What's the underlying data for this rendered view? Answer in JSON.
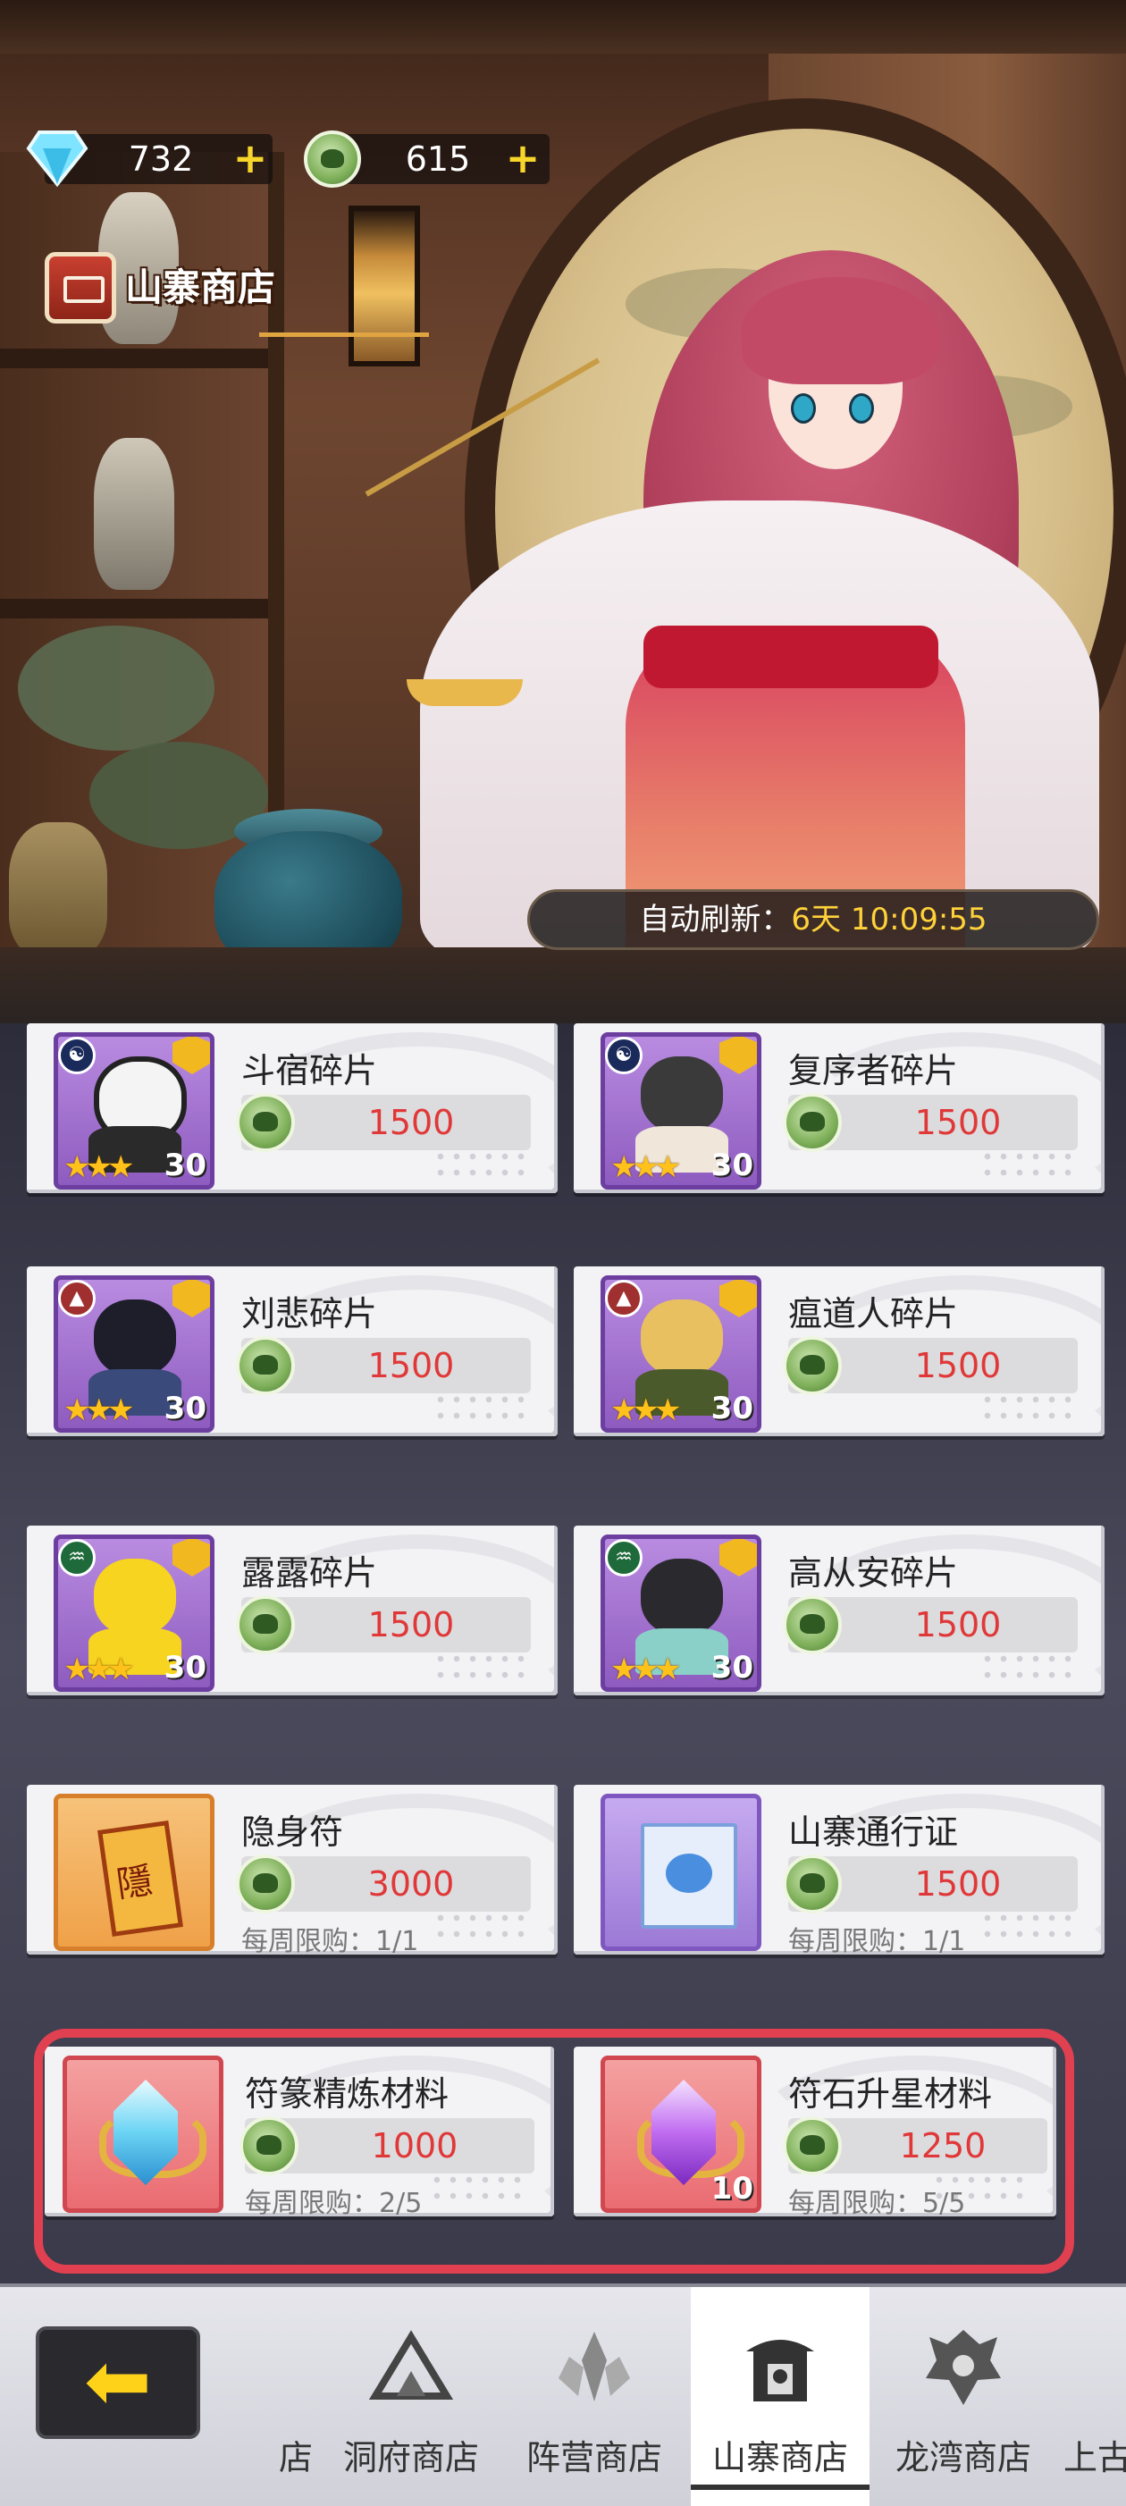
{
  "currencies": {
    "diamonds": "732",
    "frog_coins": "615"
  },
  "shop_title": "山寨商店",
  "refresh": {
    "label": "自动刷新：",
    "value": "6天 10:09:55"
  },
  "items": [
    {
      "name": "斗宿碎片",
      "price": "1500",
      "qty": "30",
      "stars": "★★★"
    },
    {
      "name": "复序者碎片",
      "price": "1500",
      "qty": "30",
      "stars": "★★★"
    },
    {
      "name": "刘悲碎片",
      "price": "1500",
      "qty": "30",
      "stars": "★★★"
    },
    {
      "name": "瘟道人碎片",
      "price": "1500",
      "qty": "30",
      "stars": "★★★"
    },
    {
      "name": "露露碎片",
      "price": "1500",
      "qty": "30",
      "stars": "★★★"
    },
    {
      "name": "高从安碎片",
      "price": "1500",
      "qty": "30",
      "stars": "★★★"
    },
    {
      "name": "隐身符",
      "price": "3000",
      "limit": "每周限购：1/1"
    },
    {
      "name": "山寨通行证",
      "price": "1500",
      "limit": "每周限购：1/1"
    },
    {
      "name": "符篆精炼材料",
      "price": "1000",
      "limit": "每周限购：2/5"
    },
    {
      "name": "符石升星材料",
      "price": "1250",
      "limit": "每周限购：5/5",
      "qty": "10"
    }
  ],
  "nav": {
    "partial_left": "店",
    "tabs": [
      "洞府商店",
      "阵营商店",
      "山寨商店",
      "龙湾商店"
    ],
    "partial_right": "上古",
    "active": "山寨商店"
  },
  "colors": {
    "price_red": "#e03838",
    "highlight_red": "#e04050",
    "refresh_gold": "#ffd23a"
  }
}
